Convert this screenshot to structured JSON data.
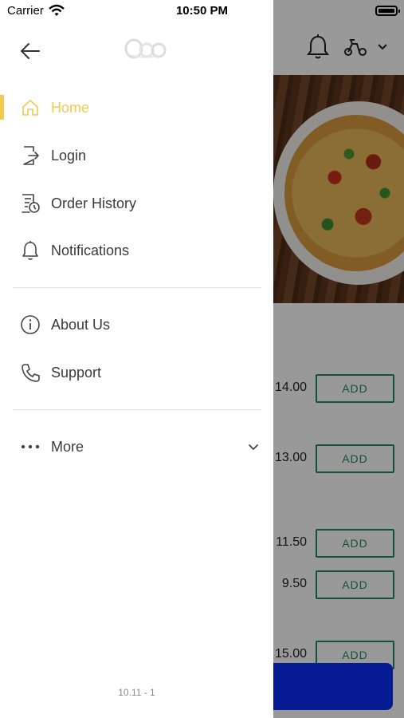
{
  "status_bar": {
    "carrier": "Carrier",
    "time": "10:50 PM"
  },
  "drawer": {
    "nav_primary": [
      {
        "label": "Home",
        "icon": "home-icon",
        "active": true
      },
      {
        "label": "Login",
        "icon": "login-icon",
        "active": false
      },
      {
        "label": "Order History",
        "icon": "order-history-icon",
        "active": false
      },
      {
        "label": "Notifications",
        "icon": "bell-icon",
        "active": false
      }
    ],
    "nav_secondary": [
      {
        "label": "About Us",
        "icon": "info-icon"
      },
      {
        "label": "Support",
        "icon": "phone-icon"
      }
    ],
    "more": {
      "label": "More",
      "icon": "more-dots-icon"
    },
    "version": "10.11 - 1"
  },
  "background_menu": {
    "items": [
      {
        "price": "14.00",
        "add_label": "ADD"
      },
      {
        "price": "13.00",
        "add_label": "ADD"
      },
      {
        "price": "11.50",
        "add_label": "ADD"
      },
      {
        "price": "9.50",
        "add_label": "ADD"
      },
      {
        "price": "15.00",
        "add_label": "ADD"
      }
    ]
  },
  "colors": {
    "accent": "#f2c94c",
    "text": "#3a3a3a",
    "add_button": "#1f8a5a",
    "cart_bar": "#0a2cf5"
  }
}
